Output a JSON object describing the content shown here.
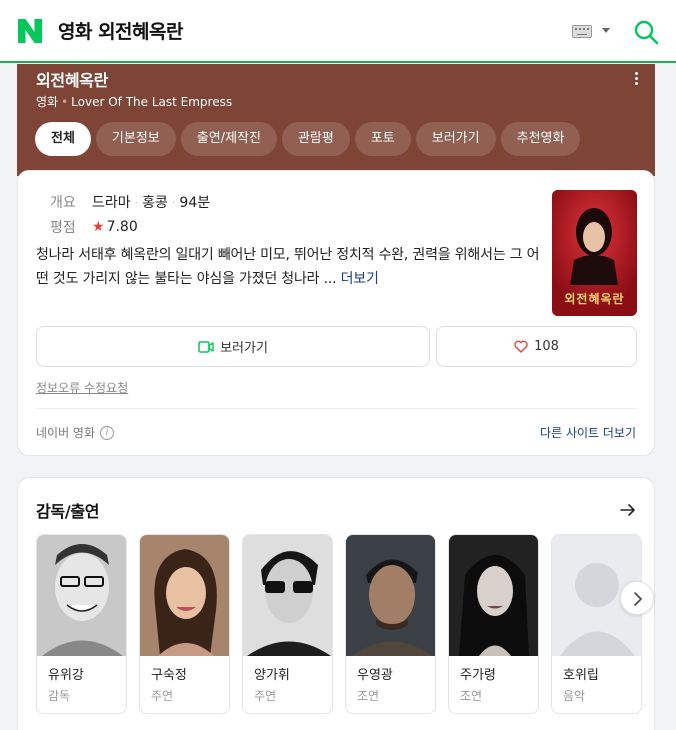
{
  "header": {
    "logo": "N",
    "query": "영화 외전혜옥란",
    "icons": [
      "keyboard-icon",
      "dropdown-caret-icon",
      "search-icon"
    ],
    "brand_color": "#03c75a"
  },
  "hero": {
    "title": "외전혜옥란",
    "category": "영화",
    "original_title": "Lover Of The Last Empress",
    "bg_color": "#7e4536",
    "tabs": [
      {
        "label": "전체",
        "active": true
      },
      {
        "label": "기본정보",
        "active": false
      },
      {
        "label": "출연/제작진",
        "active": false
      },
      {
        "label": "관람평",
        "active": false
      },
      {
        "label": "포토",
        "active": false
      },
      {
        "label": "보러가기",
        "active": false
      },
      {
        "label": "추천영화",
        "active": false
      }
    ]
  },
  "overview": {
    "summary_label": "개요",
    "genre": "드라마",
    "country": "홍콩",
    "runtime": "94분",
    "rating_label": "평점",
    "rating": "7.80",
    "synopsis": "청나라 서태후 혜옥란의 일대기 빼어난 미모, 뛰어난 정치적 수완, 권력을 위해서는 그 어떤 것도 가리지 않는 불타는 야심을 가졌던 청나라 ...",
    "more_label": "더보기",
    "poster_title": "외전혜옥란",
    "watch_button": "보러가기",
    "like_count": "108",
    "report_link": "정보오류 수정요청",
    "source_label": "네이버 영화",
    "other_sites": "다른 사이트 더보기"
  },
  "cast": {
    "section_title": "감독/출연",
    "people": [
      {
        "name": "유위강",
        "role": "감독"
      },
      {
        "name": "구숙정",
        "role": "주연"
      },
      {
        "name": "양가휘",
        "role": "주연"
      },
      {
        "name": "우영광",
        "role": "조연"
      },
      {
        "name": "주가령",
        "role": "조연"
      },
      {
        "name": "호위립",
        "role": "음악"
      }
    ]
  }
}
